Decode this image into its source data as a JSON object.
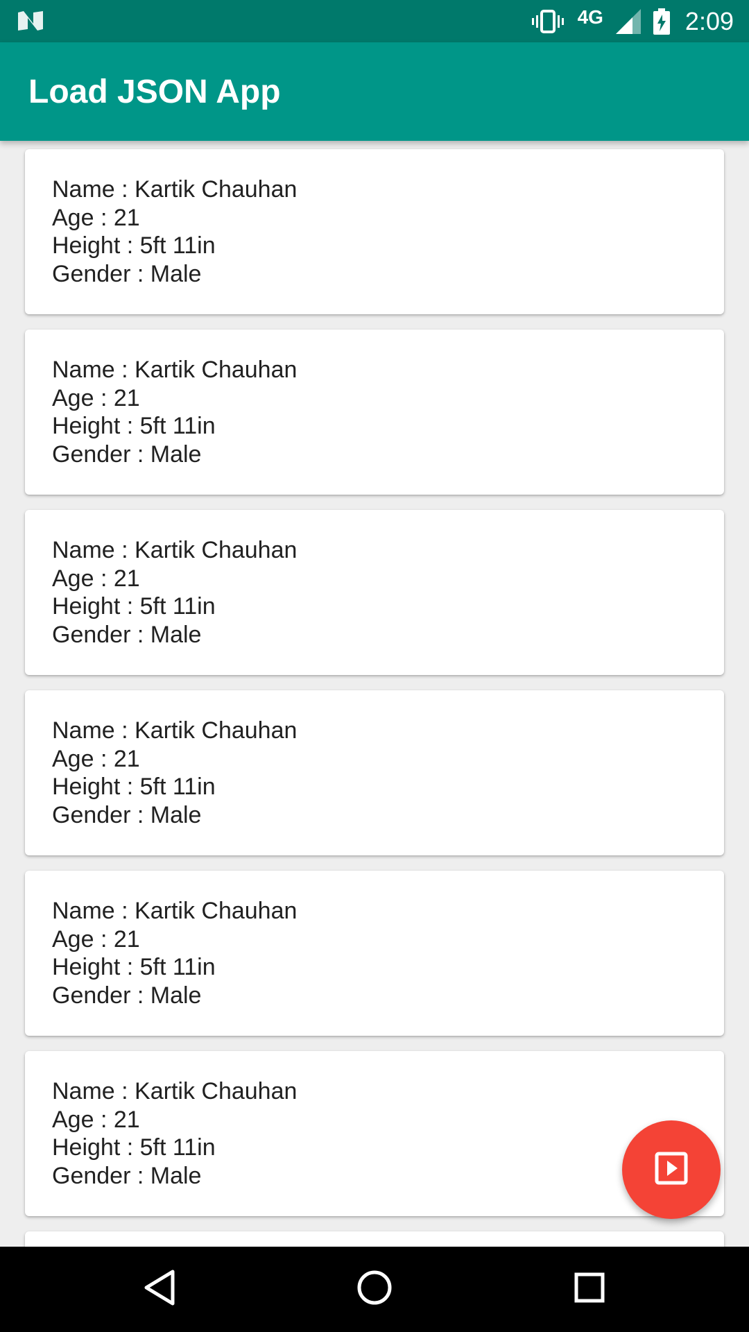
{
  "status_bar": {
    "network": "4G",
    "time": "2:09",
    "icons": [
      "n-logo-icon",
      "vibrate-icon",
      "signal-icon",
      "battery-charging-icon"
    ]
  },
  "app_bar": {
    "title": "Load JSON App"
  },
  "people": [
    {
      "name": "Name : Kartik Chauhan",
      "age": "Age : 21",
      "height": "Height : 5ft 11in",
      "gender": "Gender : Male"
    },
    {
      "name": "Name : Kartik Chauhan",
      "age": "Age : 21",
      "height": "Height : 5ft 11in",
      "gender": "Gender : Male"
    },
    {
      "name": "Name : Kartik Chauhan",
      "age": "Age : 21",
      "height": "Height : 5ft 11in",
      "gender": "Gender : Male"
    },
    {
      "name": "Name : Kartik Chauhan",
      "age": "Age : 21",
      "height": "Height : 5ft 11in",
      "gender": "Gender : Male"
    },
    {
      "name": "Name : Kartik Chauhan",
      "age": "Age : 21",
      "height": "Height : 5ft 11in",
      "gender": "Gender : Male"
    },
    {
      "name": "Name : Kartik Chauhan",
      "age": "Age : 21",
      "height": "Height : 5ft 11in",
      "gender": "Gender : Male"
    }
  ],
  "fab": {
    "icon": "play-icon",
    "color": "#f44336"
  },
  "nav_bar": {
    "icons": [
      "back-icon",
      "home-icon",
      "recents-icon"
    ]
  },
  "colors": {
    "status_bar": "#00796b",
    "app_bar": "#009688",
    "background": "#eeeeee"
  }
}
